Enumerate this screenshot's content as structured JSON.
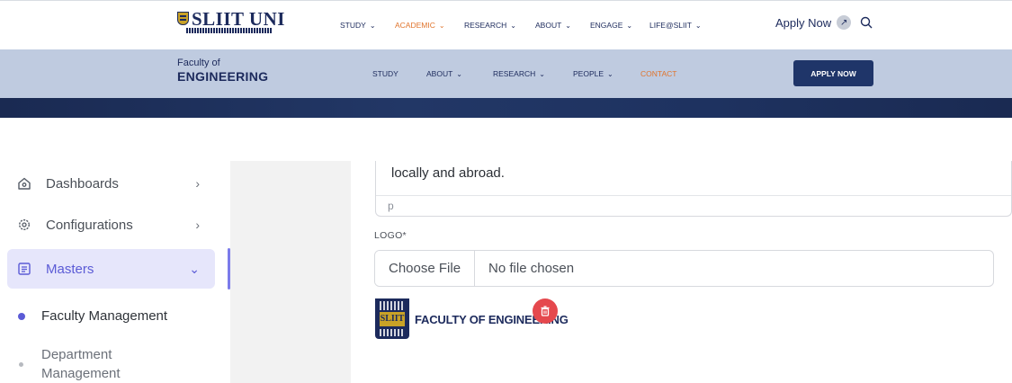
{
  "topnav": {
    "brand_name": "SLIIT UNI",
    "menu": [
      {
        "label": "STUDY"
      },
      {
        "label": "ACADEMIC"
      },
      {
        "label": "RESEARCH"
      },
      {
        "label": "ABOUT"
      },
      {
        "label": "ENGAGE"
      },
      {
        "label": "LIFE@SLIIT"
      }
    ],
    "apply_label": "Apply Now",
    "accent_color": "#e0742c",
    "brand_color": "#1c2a5c"
  },
  "facbar": {
    "title_small": "Faculty of",
    "title_big": "ENGINEERING",
    "menu": [
      {
        "label": "STUDY"
      },
      {
        "label": "ABOUT"
      },
      {
        "label": "RESEARCH"
      },
      {
        "label": "PEOPLE"
      },
      {
        "label": "CONTACT"
      }
    ],
    "apply_button": "APPLY NOW"
  },
  "sidebar": {
    "items": [
      {
        "label": "Dashboards",
        "icon": "home-icon"
      },
      {
        "label": "Configurations",
        "icon": "gear-icon"
      },
      {
        "label": "Masters",
        "icon": "list-icon"
      }
    ],
    "subitems": [
      {
        "label": "Faculty Management"
      },
      {
        "label": "Department Management"
      }
    ],
    "active_color": "#5b5bd6"
  },
  "form": {
    "editor_text": "locally and abroad.",
    "editor_tag": "p",
    "logo_label": "LOGO*",
    "choose_file": "Choose File",
    "file_status": "No file chosen",
    "preview_name": "FACULTY OF ENGINEERING",
    "preview_crest_text": "SLIIT"
  }
}
